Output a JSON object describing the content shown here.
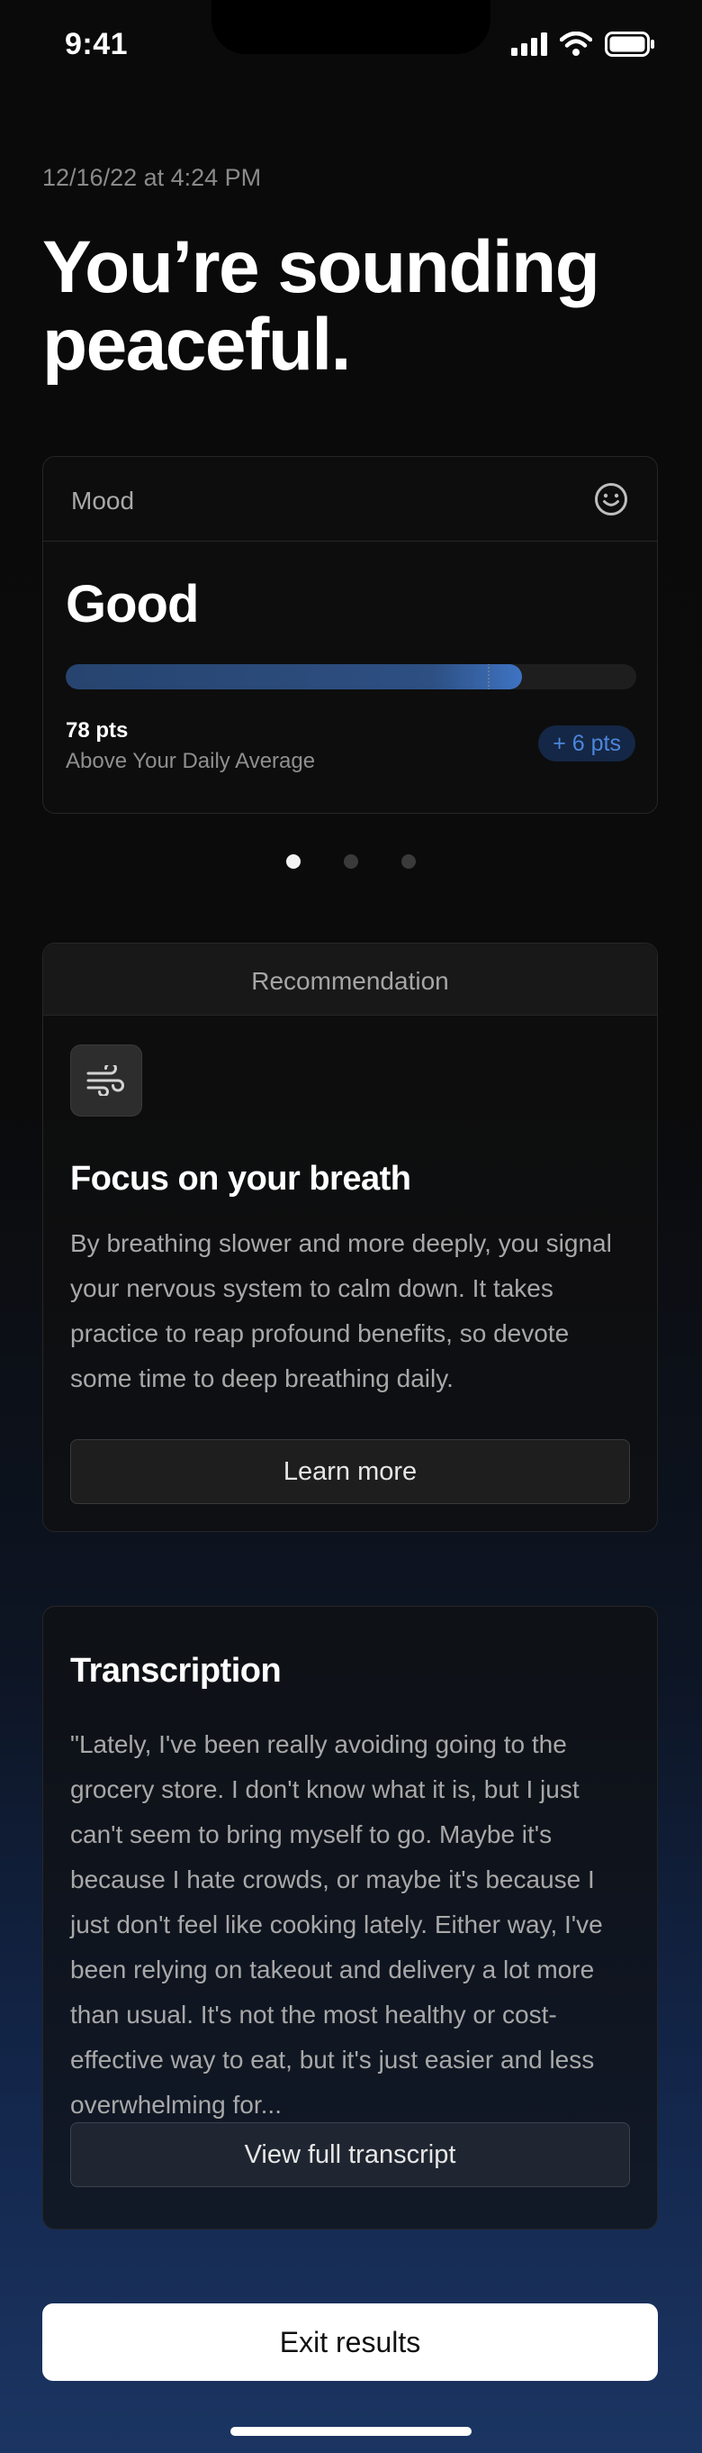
{
  "status_bar": {
    "time": "9:41"
  },
  "header": {
    "timestamp": "12/16/22 at 4:24 PM",
    "headline": "You’re sounding peaceful."
  },
  "mood": {
    "label": "Mood",
    "value": "Good",
    "score_fraction": 0.8,
    "average_fraction": 0.74,
    "points": "78 pts",
    "subtitle": "Above Your Daily Average",
    "delta": "+ 6 pts",
    "icon": "smile-icon"
  },
  "carousel": {
    "count": 3,
    "active_index": 0
  },
  "recommendation": {
    "header": "Recommendation",
    "icon": "wind-icon",
    "title": "Focus on your breath",
    "body": "By breathing slower and more deeply, you signal your nervous system to calm down. It takes practice to reap profound benefits, so devote some time to deep breathing daily.",
    "button_label": "Learn more"
  },
  "transcription": {
    "title": "Transcription",
    "body": "\"Lately, I've been really avoiding going to the grocery store. I don't know what it is, but I just can't seem to bring myself to go. Maybe it's because I hate crowds, or maybe it's because I just don't feel like cooking lately. Either way, I've been relying on takeout and delivery a lot more than usual. It's not the most healthy or cost-effective way to eat, but it's just easier and less overwhelming for...",
    "button_label": "View full transcript"
  },
  "footer": {
    "exit_label": "Exit results"
  },
  "colors": {
    "accent": "#3e73c2",
    "delta_text": "#4c86dc",
    "delta_bg": "#152746"
  }
}
